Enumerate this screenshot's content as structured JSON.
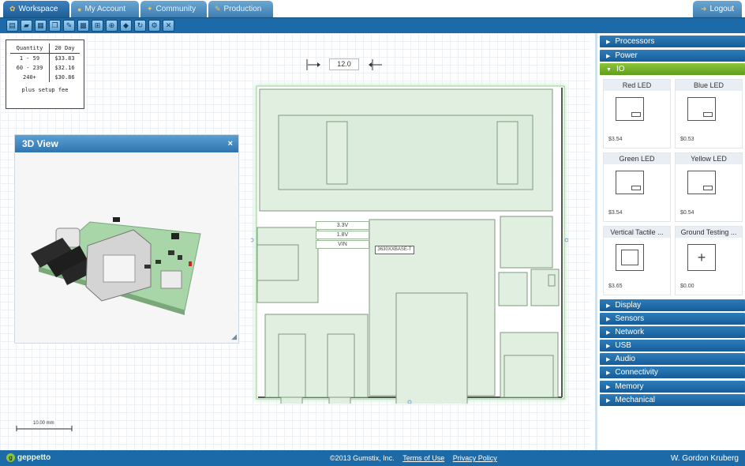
{
  "tabs": [
    {
      "label": "Workspace",
      "icon": "gear-icon",
      "active": true
    },
    {
      "label": "My Account",
      "icon": "user-icon",
      "active": false
    },
    {
      "label": "Community",
      "icon": "people-icon",
      "active": false
    },
    {
      "label": "Production",
      "icon": "factory-icon",
      "active": false
    }
  ],
  "logout_label": "Logout",
  "toolbar_icons": [
    "new-icon",
    "open-icon",
    "save-icon",
    "copy-icon",
    "pencil-icon",
    "grid-icon",
    "snap-icon",
    "zoom-icon",
    "add-part-icon",
    "rotate-icon",
    "settings-icon",
    "tools-icon"
  ],
  "price_table": {
    "headers": [
      "Quantity",
      "20 Day"
    ],
    "rows": [
      [
        "1 - 59",
        "$33.83"
      ],
      [
        "60 - 239",
        "$32.16"
      ],
      [
        "240+",
        "$30.86"
      ]
    ],
    "note": "plus setup fee"
  },
  "view3d": {
    "title": "3D View",
    "close": "×"
  },
  "scale_label": "10.00 mm",
  "dimension_value": "12.0",
  "board_labels": {
    "v33": "3.3V",
    "v18": "1.8V",
    "vin": "VIN",
    "part": "3630XXBASE-T"
  },
  "sidebar": {
    "categories_top": [
      {
        "label": "Processors"
      },
      {
        "label": "Power"
      },
      {
        "label": "IO",
        "open": true
      }
    ],
    "parts": [
      {
        "name": "Red LED",
        "price": "$3.54"
      },
      {
        "name": "Blue LED",
        "price": "$0.53"
      },
      {
        "name": "Green LED",
        "price": "$3.54"
      },
      {
        "name": "Yellow LED",
        "price": "$0.54"
      },
      {
        "name": "Vertical Tactile ...",
        "price": "$3.65"
      },
      {
        "name": "Ground Testing ...",
        "price": "$0.00"
      }
    ],
    "categories_bottom": [
      {
        "label": "Display"
      },
      {
        "label": "Sensors"
      },
      {
        "label": "Network"
      },
      {
        "label": "USB"
      },
      {
        "label": "Audio"
      },
      {
        "label": "Connectivity"
      },
      {
        "label": "Memory"
      },
      {
        "label": "Mechanical"
      }
    ]
  },
  "footer": {
    "logo": "geppetto",
    "copyright": "©2013 Gumstix, Inc.",
    "terms": "Terms of Use",
    "privacy": "Privacy Policy",
    "user": "W. Gordon Kruberg"
  }
}
